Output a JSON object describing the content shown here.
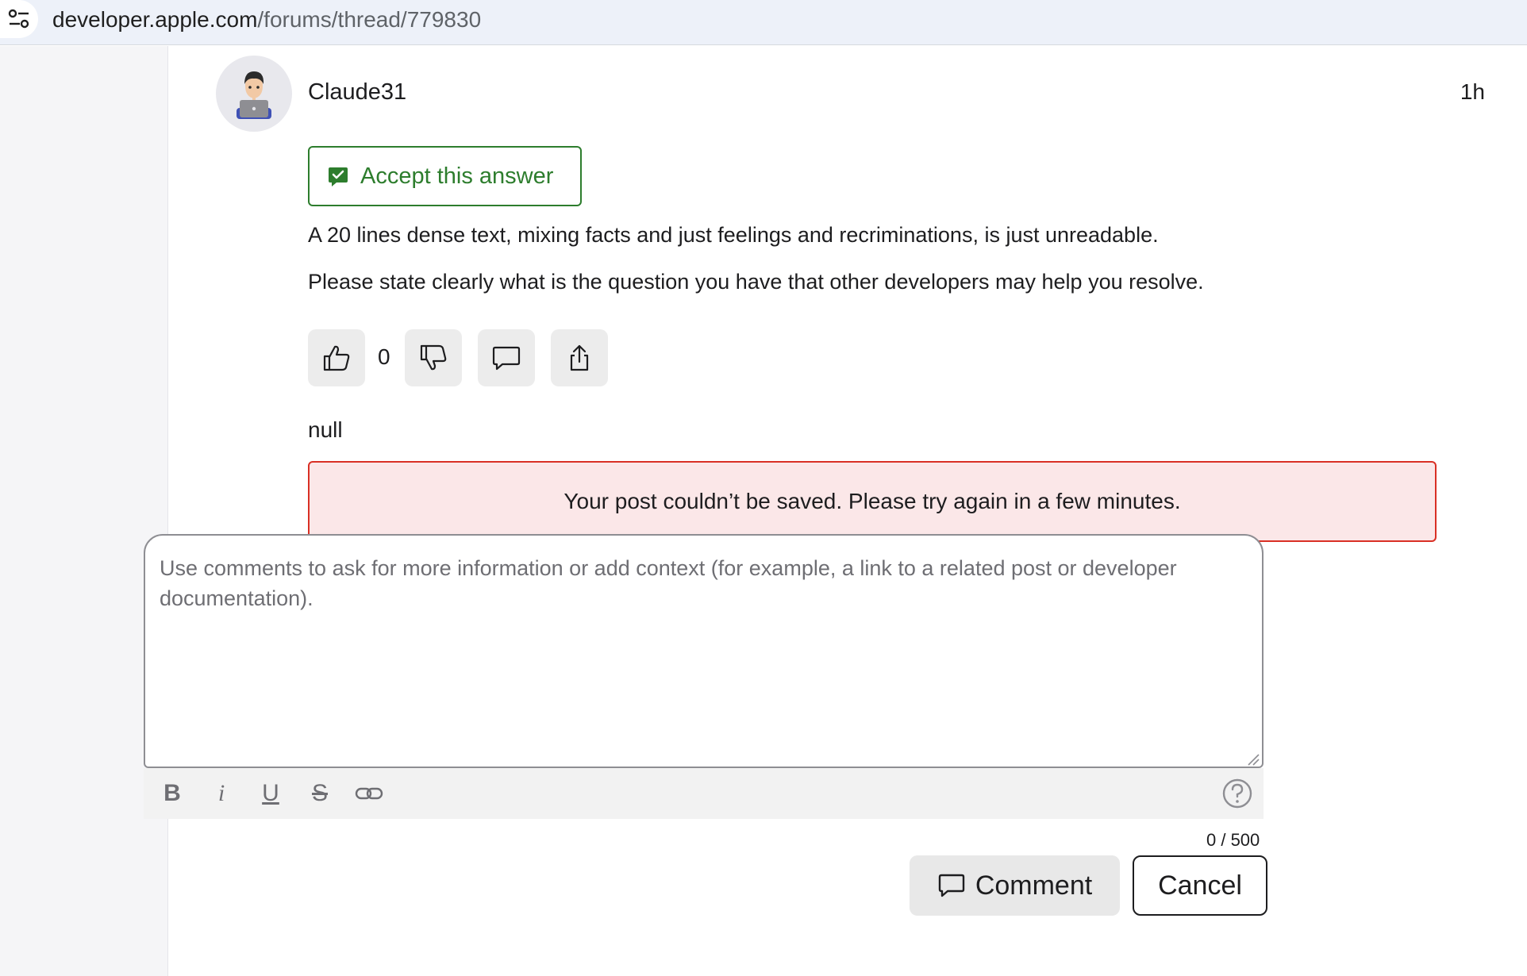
{
  "browser": {
    "url_host": "developer.apple.com",
    "url_path": "/forums/thread/779830",
    "site_info_icon": "tune-icon"
  },
  "post": {
    "author": "Claude31",
    "avatar_icon": "person-at-laptop-memoji",
    "time": "1h",
    "accept_label": "Accept this answer",
    "paragraphs": [
      "A 20 lines dense text, mixing facts and just feelings and recriminations, is just unreadable.",
      "Please state clearly what is the question you have that other developers may help you resolve."
    ],
    "vote_count": "0",
    "null_text": "null"
  },
  "error": {
    "message": "Your post couldn’t be saved. Please try again in a few minutes."
  },
  "comment": {
    "placeholder": "Use comments to ask for more information or add context (for example, a link to a related post or developer documentation).",
    "value": "",
    "toolbar": {
      "bold": "B",
      "italic": "i",
      "underline": "U",
      "strike": "S"
    },
    "char_count": "0 / 500",
    "submit_label": "Comment",
    "cancel_label": "Cancel"
  },
  "colors": {
    "accept_green": "#2d7d2d",
    "error_border": "#d93025",
    "error_bg": "#fbe7e8",
    "urlbar_bg": "#edf1f9"
  }
}
